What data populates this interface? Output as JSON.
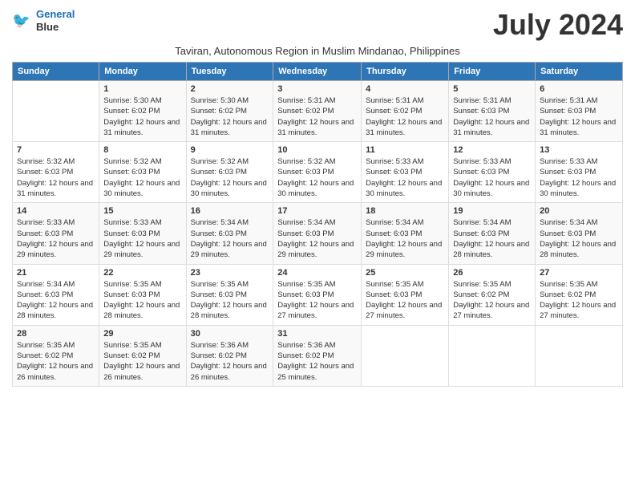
{
  "header": {
    "logo_line1": "General",
    "logo_line2": "Blue",
    "month_title": "July 2024",
    "subtitle": "Taviran, Autonomous Region in Muslim Mindanao, Philippines"
  },
  "weekdays": [
    "Sunday",
    "Monday",
    "Tuesday",
    "Wednesday",
    "Thursday",
    "Friday",
    "Saturday"
  ],
  "weeks": [
    [
      {
        "day": "",
        "sunrise": "",
        "sunset": "",
        "daylight": ""
      },
      {
        "day": "1",
        "sunrise": "Sunrise: 5:30 AM",
        "sunset": "Sunset: 6:02 PM",
        "daylight": "Daylight: 12 hours and 31 minutes."
      },
      {
        "day": "2",
        "sunrise": "Sunrise: 5:30 AM",
        "sunset": "Sunset: 6:02 PM",
        "daylight": "Daylight: 12 hours and 31 minutes."
      },
      {
        "day": "3",
        "sunrise": "Sunrise: 5:31 AM",
        "sunset": "Sunset: 6:02 PM",
        "daylight": "Daylight: 12 hours and 31 minutes."
      },
      {
        "day": "4",
        "sunrise": "Sunrise: 5:31 AM",
        "sunset": "Sunset: 6:02 PM",
        "daylight": "Daylight: 12 hours and 31 minutes."
      },
      {
        "day": "5",
        "sunrise": "Sunrise: 5:31 AM",
        "sunset": "Sunset: 6:03 PM",
        "daylight": "Daylight: 12 hours and 31 minutes."
      },
      {
        "day": "6",
        "sunrise": "Sunrise: 5:31 AM",
        "sunset": "Sunset: 6:03 PM",
        "daylight": "Daylight: 12 hours and 31 minutes."
      }
    ],
    [
      {
        "day": "7",
        "sunrise": "Sunrise: 5:32 AM",
        "sunset": "Sunset: 6:03 PM",
        "daylight": "Daylight: 12 hours and 31 minutes."
      },
      {
        "day": "8",
        "sunrise": "Sunrise: 5:32 AM",
        "sunset": "Sunset: 6:03 PM",
        "daylight": "Daylight: 12 hours and 30 minutes."
      },
      {
        "day": "9",
        "sunrise": "Sunrise: 5:32 AM",
        "sunset": "Sunset: 6:03 PM",
        "daylight": "Daylight: 12 hours and 30 minutes."
      },
      {
        "day": "10",
        "sunrise": "Sunrise: 5:32 AM",
        "sunset": "Sunset: 6:03 PM",
        "daylight": "Daylight: 12 hours and 30 minutes."
      },
      {
        "day": "11",
        "sunrise": "Sunrise: 5:33 AM",
        "sunset": "Sunset: 6:03 PM",
        "daylight": "Daylight: 12 hours and 30 minutes."
      },
      {
        "day": "12",
        "sunrise": "Sunrise: 5:33 AM",
        "sunset": "Sunset: 6:03 PM",
        "daylight": "Daylight: 12 hours and 30 minutes."
      },
      {
        "day": "13",
        "sunrise": "Sunrise: 5:33 AM",
        "sunset": "Sunset: 6:03 PM",
        "daylight": "Daylight: 12 hours and 30 minutes."
      }
    ],
    [
      {
        "day": "14",
        "sunrise": "Sunrise: 5:33 AM",
        "sunset": "Sunset: 6:03 PM",
        "daylight": "Daylight: 12 hours and 29 minutes."
      },
      {
        "day": "15",
        "sunrise": "Sunrise: 5:33 AM",
        "sunset": "Sunset: 6:03 PM",
        "daylight": "Daylight: 12 hours and 29 minutes."
      },
      {
        "day": "16",
        "sunrise": "Sunrise: 5:34 AM",
        "sunset": "Sunset: 6:03 PM",
        "daylight": "Daylight: 12 hours and 29 minutes."
      },
      {
        "day": "17",
        "sunrise": "Sunrise: 5:34 AM",
        "sunset": "Sunset: 6:03 PM",
        "daylight": "Daylight: 12 hours and 29 minutes."
      },
      {
        "day": "18",
        "sunrise": "Sunrise: 5:34 AM",
        "sunset": "Sunset: 6:03 PM",
        "daylight": "Daylight: 12 hours and 29 minutes."
      },
      {
        "day": "19",
        "sunrise": "Sunrise: 5:34 AM",
        "sunset": "Sunset: 6:03 PM",
        "daylight": "Daylight: 12 hours and 28 minutes."
      },
      {
        "day": "20",
        "sunrise": "Sunrise: 5:34 AM",
        "sunset": "Sunset: 6:03 PM",
        "daylight": "Daylight: 12 hours and 28 minutes."
      }
    ],
    [
      {
        "day": "21",
        "sunrise": "Sunrise: 5:34 AM",
        "sunset": "Sunset: 6:03 PM",
        "daylight": "Daylight: 12 hours and 28 minutes."
      },
      {
        "day": "22",
        "sunrise": "Sunrise: 5:35 AM",
        "sunset": "Sunset: 6:03 PM",
        "daylight": "Daylight: 12 hours and 28 minutes."
      },
      {
        "day": "23",
        "sunrise": "Sunrise: 5:35 AM",
        "sunset": "Sunset: 6:03 PM",
        "daylight": "Daylight: 12 hours and 28 minutes."
      },
      {
        "day": "24",
        "sunrise": "Sunrise: 5:35 AM",
        "sunset": "Sunset: 6:03 PM",
        "daylight": "Daylight: 12 hours and 27 minutes."
      },
      {
        "day": "25",
        "sunrise": "Sunrise: 5:35 AM",
        "sunset": "Sunset: 6:03 PM",
        "daylight": "Daylight: 12 hours and 27 minutes."
      },
      {
        "day": "26",
        "sunrise": "Sunrise: 5:35 AM",
        "sunset": "Sunset: 6:02 PM",
        "daylight": "Daylight: 12 hours and 27 minutes."
      },
      {
        "day": "27",
        "sunrise": "Sunrise: 5:35 AM",
        "sunset": "Sunset: 6:02 PM",
        "daylight": "Daylight: 12 hours and 27 minutes."
      }
    ],
    [
      {
        "day": "28",
        "sunrise": "Sunrise: 5:35 AM",
        "sunset": "Sunset: 6:02 PM",
        "daylight": "Daylight: 12 hours and 26 minutes."
      },
      {
        "day": "29",
        "sunrise": "Sunrise: 5:35 AM",
        "sunset": "Sunset: 6:02 PM",
        "daylight": "Daylight: 12 hours and 26 minutes."
      },
      {
        "day": "30",
        "sunrise": "Sunrise: 5:36 AM",
        "sunset": "Sunset: 6:02 PM",
        "daylight": "Daylight: 12 hours and 26 minutes."
      },
      {
        "day": "31",
        "sunrise": "Sunrise: 5:36 AM",
        "sunset": "Sunset: 6:02 PM",
        "daylight": "Daylight: 12 hours and 25 minutes."
      },
      {
        "day": "",
        "sunrise": "",
        "sunset": "",
        "daylight": ""
      },
      {
        "day": "",
        "sunrise": "",
        "sunset": "",
        "daylight": ""
      },
      {
        "day": "",
        "sunrise": "",
        "sunset": "",
        "daylight": ""
      }
    ]
  ]
}
